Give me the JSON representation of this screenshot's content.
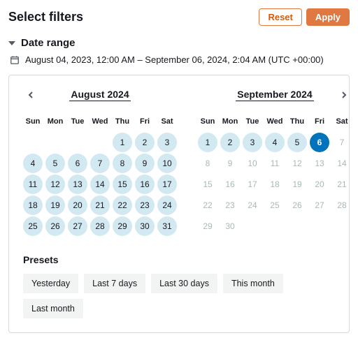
{
  "header": {
    "title": "Select filters",
    "reset_label": "Reset",
    "apply_label": "Apply"
  },
  "section": {
    "label": "Date range"
  },
  "range_text": "August 04, 2023, 12:00 AM – September 06, 2024, 2:04 AM (UTC +00:00)",
  "dow": [
    "Sun",
    "Mon",
    "Tue",
    "Wed",
    "Thu",
    "Fri",
    "Sat"
  ],
  "month_left": {
    "title": "August  2024",
    "leading_blanks": 4,
    "days": [
      {
        "n": 1,
        "range": true
      },
      {
        "n": 2,
        "range": true
      },
      {
        "n": 3,
        "range": true
      },
      {
        "n": 4,
        "range": true
      },
      {
        "n": 5,
        "range": true
      },
      {
        "n": 6,
        "range": true
      },
      {
        "n": 7,
        "range": true
      },
      {
        "n": 8,
        "range": true
      },
      {
        "n": 9,
        "range": true
      },
      {
        "n": 10,
        "range": true
      },
      {
        "n": 11,
        "range": true
      },
      {
        "n": 12,
        "range": true
      },
      {
        "n": 13,
        "range": true
      },
      {
        "n": 14,
        "range": true
      },
      {
        "n": 15,
        "range": true
      },
      {
        "n": 16,
        "range": true
      },
      {
        "n": 17,
        "range": true
      },
      {
        "n": 18,
        "range": true
      },
      {
        "n": 19,
        "range": true
      },
      {
        "n": 20,
        "range": true
      },
      {
        "n": 21,
        "range": true
      },
      {
        "n": 22,
        "range": true
      },
      {
        "n": 23,
        "range": true
      },
      {
        "n": 24,
        "range": true
      },
      {
        "n": 25,
        "range": true
      },
      {
        "n": 26,
        "range": true
      },
      {
        "n": 27,
        "range": true
      },
      {
        "n": 28,
        "range": true
      },
      {
        "n": 29,
        "range": true
      },
      {
        "n": 30,
        "range": true
      },
      {
        "n": 31,
        "range": true
      }
    ]
  },
  "month_right": {
    "title": "September  2024",
    "leading_blanks": 0,
    "days": [
      {
        "n": 1,
        "range": true
      },
      {
        "n": 2,
        "range": true
      },
      {
        "n": 3,
        "range": true
      },
      {
        "n": 4,
        "range": true
      },
      {
        "n": 5,
        "range": true
      },
      {
        "n": 6,
        "selected": true
      },
      {
        "n": 7,
        "disabled": true
      },
      {
        "n": 8,
        "disabled": true
      },
      {
        "n": 9,
        "disabled": true
      },
      {
        "n": 10,
        "disabled": true
      },
      {
        "n": 11,
        "disabled": true
      },
      {
        "n": 12,
        "disabled": true
      },
      {
        "n": 13,
        "disabled": true
      },
      {
        "n": 14,
        "disabled": true
      },
      {
        "n": 15,
        "disabled": true
      },
      {
        "n": 16,
        "disabled": true
      },
      {
        "n": 17,
        "disabled": true
      },
      {
        "n": 18,
        "disabled": true
      },
      {
        "n": 19,
        "disabled": true
      },
      {
        "n": 20,
        "disabled": true
      },
      {
        "n": 21,
        "disabled": true
      },
      {
        "n": 22,
        "disabled": true
      },
      {
        "n": 23,
        "disabled": true
      },
      {
        "n": 24,
        "disabled": true
      },
      {
        "n": 25,
        "disabled": true
      },
      {
        "n": 26,
        "disabled": true
      },
      {
        "n": 27,
        "disabled": true
      },
      {
        "n": 28,
        "disabled": true
      },
      {
        "n": 29,
        "disabled": true
      },
      {
        "n": 30,
        "disabled": true
      }
    ]
  },
  "presets": {
    "label": "Presets",
    "items": [
      "Yesterday",
      "Last 7 days",
      "Last 30 days",
      "This month",
      "Last month"
    ]
  }
}
